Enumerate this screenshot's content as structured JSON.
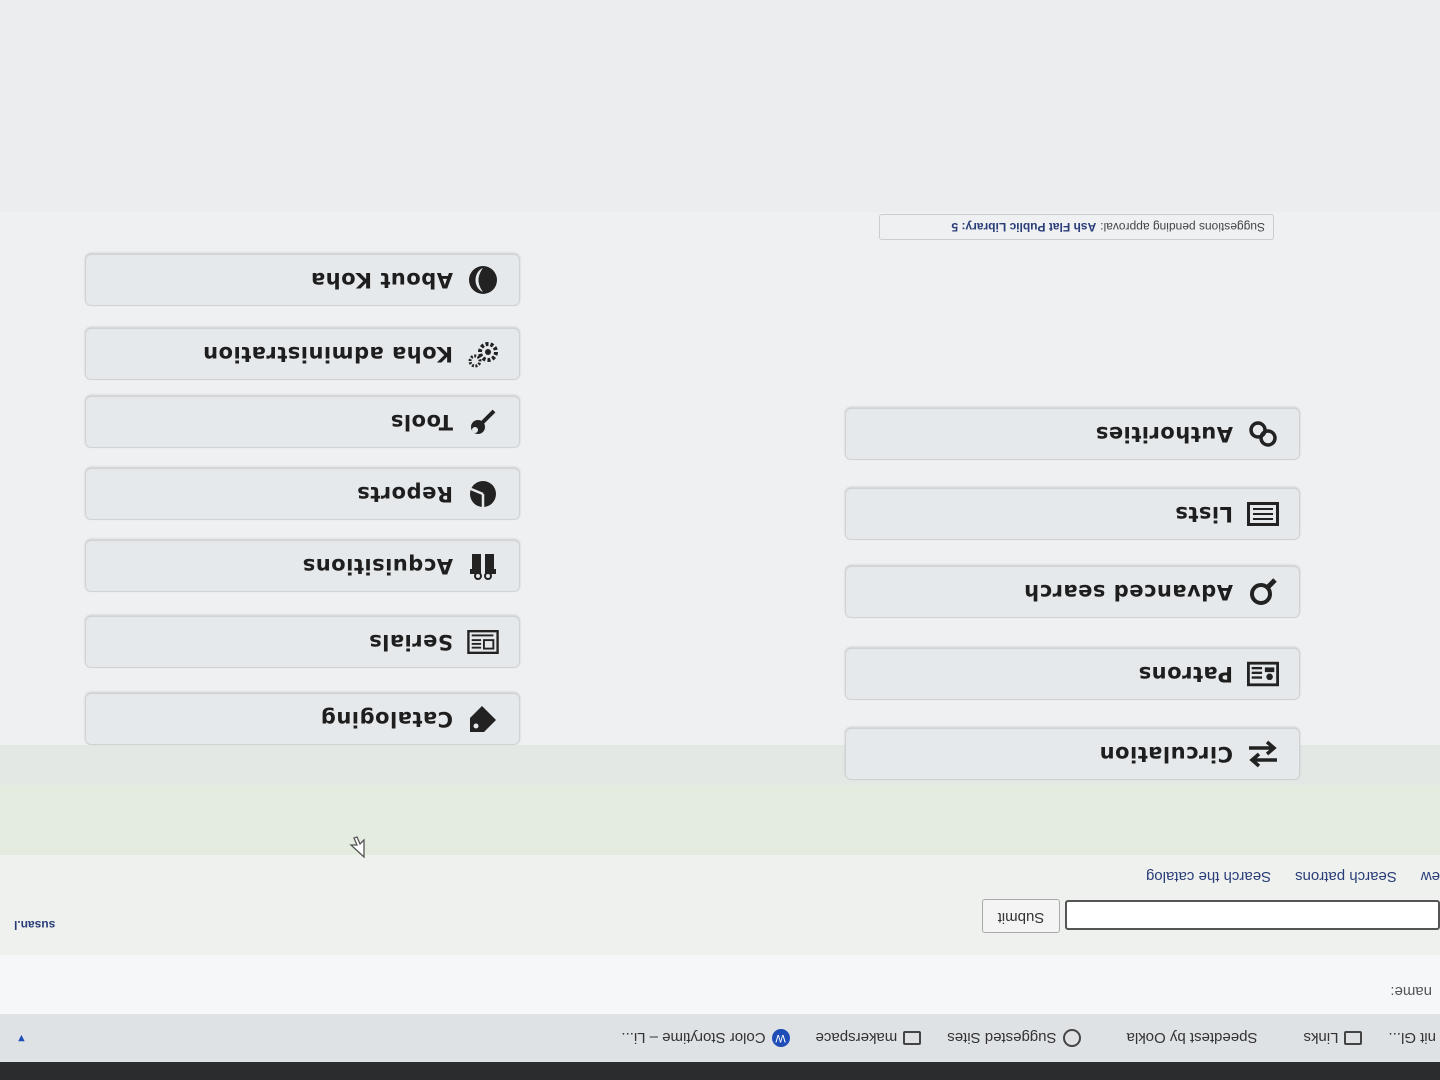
{
  "favorites_bar": {
    "items": [
      {
        "label": "nit Gl...",
        "icon": "none"
      },
      {
        "label": "Links",
        "icon": "folder-icon"
      },
      {
        "label": "Speedtest by Ookla",
        "icon": "none"
      },
      {
        "label": "Suggested Sites",
        "icon": "globe-icon"
      },
      {
        "label": "makerspace",
        "icon": "folder-icon"
      },
      {
        "label": "Color Storytime – Li...",
        "icon": "wordpress-icon"
      }
    ]
  },
  "header": {
    "login_label": "name:",
    "user": "susan.l",
    "submit_label": "Submit",
    "tabs": [
      "ew",
      "Search patrons",
      "Search the catalog"
    ]
  },
  "modules": {
    "left": [
      {
        "label": "Circulation",
        "icon": "arrows-exchange-icon"
      },
      {
        "label": "Patrons",
        "icon": "id-card-icon"
      },
      {
        "label": "Advanced search",
        "icon": "search-icon"
      },
      {
        "label": "Lists",
        "icon": "list-icon"
      },
      {
        "label": "Authorities",
        "icon": "link-icon"
      }
    ],
    "right": [
      {
        "label": "Cataloging",
        "icon": "tag-icon"
      },
      {
        "label": "Serials",
        "icon": "newspaper-icon"
      },
      {
        "label": "Acquisitions",
        "icon": "gift-icon"
      },
      {
        "label": "Reports",
        "icon": "pie-chart-icon"
      },
      {
        "label": "Tools",
        "icon": "wrench-icon"
      },
      {
        "label": "Koha administration",
        "icon": "gears-icon"
      },
      {
        "label": "About Koha",
        "icon": "koha-logo-icon"
      }
    ]
  },
  "suggestions": {
    "text": "Suggestions pending approval:",
    "link": "Ash Flat Public Library: 5"
  }
}
